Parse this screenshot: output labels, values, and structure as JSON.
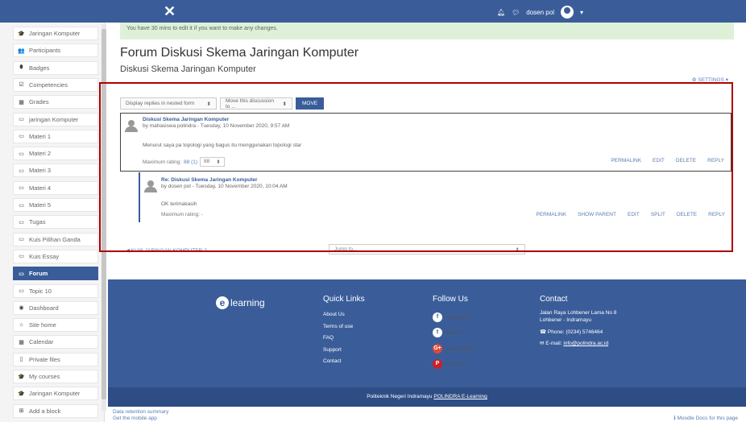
{
  "topbar": {
    "close_glyph": "✕",
    "user_name": "dosen pol",
    "bell_icon": "bell-icon",
    "chat_icon": "chat-icon",
    "caret": "▾"
  },
  "sidebar": {
    "items": [
      {
        "icon": "graduation-cap-icon",
        "glyph": "🎓",
        "label": "Jaringan Komputer"
      },
      {
        "icon": "users-icon",
        "glyph": "👥",
        "label": "Participants"
      },
      {
        "icon": "badge-icon",
        "glyph": "⬮",
        "label": "Badges"
      },
      {
        "icon": "check-square-icon",
        "glyph": "☑",
        "label": "Competencies"
      },
      {
        "icon": "table-icon",
        "glyph": "▦",
        "label": "Grades"
      },
      {
        "icon": "folder-icon",
        "glyph": "▭",
        "label": "jaringan Komputer"
      },
      {
        "icon": "folder-icon",
        "glyph": "▭",
        "label": "Materi 1"
      },
      {
        "icon": "folder-icon",
        "glyph": "▭",
        "label": "Materi 2"
      },
      {
        "icon": "folder-icon",
        "glyph": "▭",
        "label": "Materi 3"
      },
      {
        "icon": "folder-icon",
        "glyph": "▭",
        "label": "Materi 4"
      },
      {
        "icon": "folder-icon",
        "glyph": "▭",
        "label": "Materi 5"
      },
      {
        "icon": "folder-icon",
        "glyph": "▭",
        "label": "Tugas"
      },
      {
        "icon": "folder-icon",
        "glyph": "▭",
        "label": "Kuis Pilihan Ganda"
      },
      {
        "icon": "folder-icon",
        "glyph": "▭",
        "label": "Kuis Essay"
      },
      {
        "icon": "folder-icon",
        "glyph": "▭",
        "label": "Forum",
        "active": true
      },
      {
        "icon": "folder-icon",
        "glyph": "▭",
        "label": "Topic 10"
      },
      {
        "icon": "dashboard-icon",
        "glyph": "◉",
        "label": "Dashboard"
      },
      {
        "icon": "home-icon",
        "glyph": "⌂",
        "label": "Site home"
      },
      {
        "icon": "calendar-icon",
        "glyph": "▦",
        "label": "Calendar"
      },
      {
        "icon": "file-icon",
        "glyph": "▯",
        "label": "Private files"
      },
      {
        "icon": "graduation-cap-icon",
        "glyph": "🎓",
        "label": "My courses"
      },
      {
        "icon": "graduation-cap-icon",
        "glyph": "🎓",
        "label": "Jaringan Komputer"
      },
      {
        "icon": "plus-square-icon",
        "glyph": "⊞",
        "label": "Add a block"
      }
    ]
  },
  "notice": "You have 30 mins to edit it if you want to make any changes.",
  "page": {
    "title": "Forum Diskusi Skema Jaringan Komputer",
    "subtitle": "Diskusi Skema Jaringan Komputer",
    "settings": "⚙ SETTINGS ▾"
  },
  "controls": {
    "display_select": "Display replies in nested form",
    "move_select": "Move this discussion to ...",
    "move_button": "MOVE",
    "arrow": "⬍"
  },
  "post1": {
    "title": "Diskusi Skema Jaringan Komputer",
    "by": "by mahasiswa polindra - Tuesday, 10 November 2020, 9:57 AM",
    "body": "Menurut saya pa topologi yang bagus itu menggunakan topologi star",
    "rating_label": "Maximum rating:",
    "rating_value": "88 (1)",
    "rating_select": "88",
    "actions": [
      "PERMALINK",
      "EDIT",
      "DELETE",
      "REPLY"
    ]
  },
  "post2": {
    "title": "Re: Diskusi Skema Jaringan Komputer",
    "by": "by dosen pol - Tuesday, 10 November 2020, 10:04 AM",
    "body": "OK terimakasih",
    "rating_label": "Maximum rating: -",
    "actions": [
      "PERMALINK",
      "SHOW PARENT",
      "EDIT",
      "SPLIT",
      "DELETE",
      "REPLY"
    ]
  },
  "nav": {
    "prev": "◀ KUIS JARINGAN KOMPUTER 2",
    "jump": "Jump to...",
    "jump_arrow": "⬍"
  },
  "footer": {
    "logo_letter": "e",
    "logo_text": "learning",
    "quick_links_title": "Quick Links",
    "quick_links": [
      "About Us",
      "Terms of use",
      "FAQ",
      "Support",
      "Contact"
    ],
    "follow_title": "Follow Us",
    "follow": [
      {
        "icon": "facebook-icon",
        "glyph": "f",
        "label": "Facebook"
      },
      {
        "icon": "twitter-icon",
        "glyph": "t",
        "label": "Twitter"
      },
      {
        "icon": "google-plus-icon",
        "glyph": "G+",
        "label": "Google Plus"
      },
      {
        "icon": "pinterest-icon",
        "glyph": "P",
        "label": "Pinterest"
      }
    ],
    "contact_title": "Contact",
    "address1": "Jalan Raya Lohbener Lama No 8",
    "address2": "Lohbener - Indramayu",
    "phone": "Phone: (0234) 5746464",
    "email_label": "E-mail:",
    "email": "info@polindra.ac.id",
    "bottom_text": "Politeknik Negeri Indramayu",
    "bottom_link": "POLINDRA E-Learning"
  },
  "below": {
    "data_retention": "Data retention summary",
    "mobile_app": "Get the mobile app",
    "moodle_docs": "Moodle Docs for this page"
  }
}
